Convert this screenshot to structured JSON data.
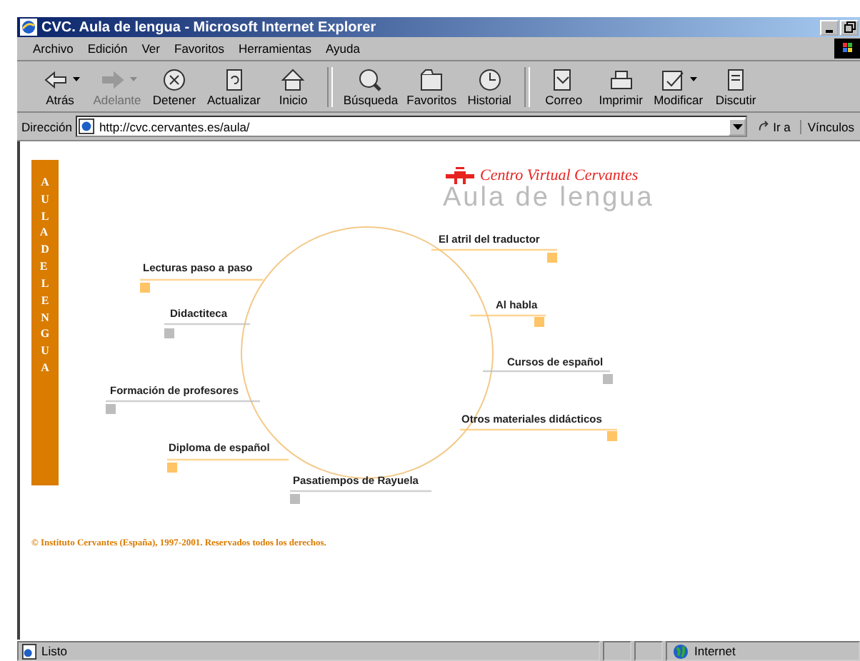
{
  "window": {
    "title": "CVC. Aula de lengua - Microsoft Internet Explorer"
  },
  "menu": [
    "Archivo",
    "Edición",
    "Ver",
    "Favoritos",
    "Herramientas",
    "Ayuda"
  ],
  "toolbar": {
    "groups": [
      [
        {
          "kind": "back",
          "label": "Atrás",
          "disabled": false,
          "has_menu": true
        },
        {
          "kind": "forward",
          "label": "Adelante",
          "disabled": true,
          "has_menu": true
        },
        {
          "kind": "stop",
          "label": "Detener",
          "disabled": false,
          "has_menu": false
        },
        {
          "kind": "refresh",
          "label": "Actualizar",
          "disabled": false,
          "has_menu": false
        },
        {
          "kind": "home",
          "label": "Inicio",
          "disabled": false,
          "has_menu": false
        }
      ],
      [
        {
          "kind": "search",
          "label": "Búsqueda",
          "disabled": false,
          "has_menu": false
        },
        {
          "kind": "favorites",
          "label": "Favoritos",
          "disabled": false,
          "has_menu": false
        },
        {
          "kind": "history",
          "label": "Historial",
          "disabled": false,
          "has_menu": false
        }
      ],
      [
        {
          "kind": "mail",
          "label": "Correo",
          "disabled": false,
          "has_menu": false
        },
        {
          "kind": "print",
          "label": "Imprimir",
          "disabled": false,
          "has_menu": false
        },
        {
          "kind": "edit",
          "label": "Modificar",
          "disabled": false,
          "has_menu": true
        },
        {
          "kind": "discuss",
          "label": "Discutir",
          "disabled": false,
          "has_menu": false
        }
      ]
    ]
  },
  "address_bar": {
    "label": "Dirección",
    "value": "http://cvc.cervantes.es/aula/",
    "go": "Ir a",
    "links": "Vínculos"
  },
  "page": {
    "side_banner": "AULA DE LENGUA",
    "brand": "Centro Virtual Cervantes",
    "heading": "Aula de lengua",
    "menu_items": [
      {
        "label": "Lecturas paso a paso",
        "color": "#ffc466"
      },
      {
        "label": "Didactiteca",
        "color": "#bdbdbd"
      },
      {
        "label": "Formación de profesores",
        "color": "#bdbdbd"
      },
      {
        "label": "Diploma de español",
        "color": "#ffc466"
      },
      {
        "label": "Pasatiempos de Rayuela",
        "color": "#bdbdbd"
      },
      {
        "label": "El atril del traductor",
        "color": "#ffc466"
      },
      {
        "label": "Al habla",
        "color": "#ffc466"
      },
      {
        "label": "Cursos de español",
        "color": "#bdbdbd"
      },
      {
        "label": "Otros materiales didácticos",
        "color": "#ffc466"
      }
    ],
    "copyright": "© Instituto Cervantes (España), 1997-2001. Reservados todos los derechos."
  },
  "status_bar": {
    "text": "Listo",
    "zone": "Internet"
  }
}
